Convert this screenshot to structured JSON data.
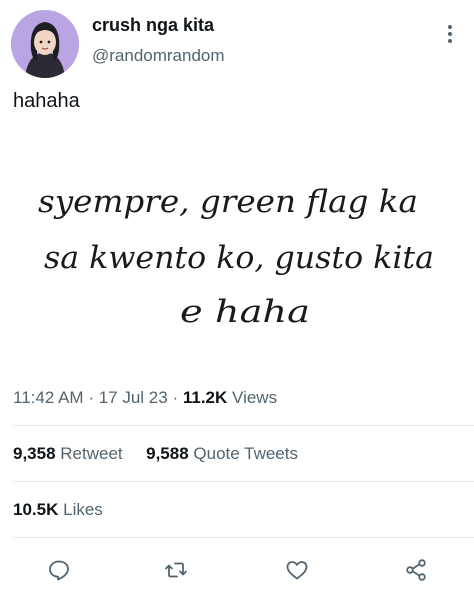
{
  "user": {
    "display_name": "crush nga kita",
    "handle": "@randomrandom"
  },
  "tweet": {
    "text": "hahaha",
    "image_text_line1": "syempre, green flag ka",
    "image_text_line2": "sa kwento ko, gusto kita",
    "image_text_line3": "e haha"
  },
  "meta": {
    "time": "11:42 AM",
    "separator": "·",
    "date": "17 Jul 23",
    "views_count": "11.2K",
    "views_label": "Views"
  },
  "stats": {
    "retweets_count": "9,358",
    "retweets_label": "Retweet",
    "quotes_count": "9,588",
    "quotes_label": "Quote Tweets",
    "likes_count": "10.5K",
    "likes_label": "Likes"
  },
  "icons": {
    "more": "more-vertical-icon",
    "reply": "reply-icon",
    "retweet": "retweet-icon",
    "like": "heart-icon",
    "share": "share-icon"
  },
  "colors": {
    "text": "#0f1419",
    "secondary": "#536471",
    "accent": "#1d9bf0"
  }
}
